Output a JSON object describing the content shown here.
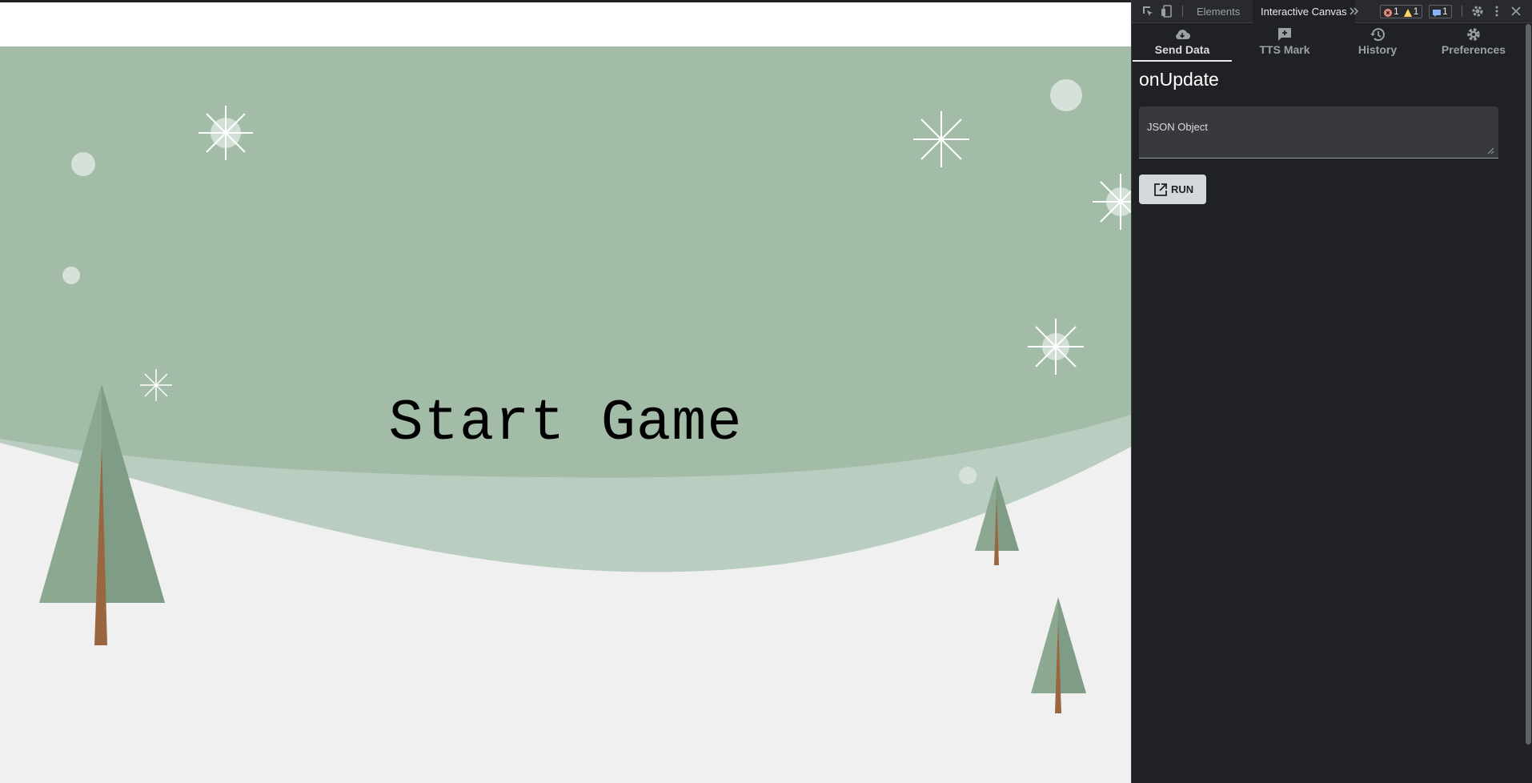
{
  "game": {
    "start_label": "Start Game",
    "colors": {
      "sky": "#a2bca8",
      "hill": "#b9cdc1",
      "ground": "#f0f0f0",
      "tree": "#8ca890",
      "trunk": "#9a6640",
      "snow": "#ffffff"
    }
  },
  "devtools": {
    "toolbar": {
      "tabs": [
        {
          "label": "Elements",
          "active": false
        },
        {
          "label": "Interactive Canvas",
          "active": true
        }
      ],
      "more_icon": "chevron-double-right-icon",
      "badges": {
        "errors": "1",
        "warnings": "1",
        "messages": "1"
      }
    },
    "nav": {
      "tabs": [
        {
          "label": "Send Data",
          "icon": "cloud-download-icon",
          "active": true
        },
        {
          "label": "TTS Mark",
          "icon": "add-comment-icon",
          "active": false
        },
        {
          "label": "History",
          "icon": "history-icon",
          "active": false
        },
        {
          "label": "Preferences",
          "icon": "gear-icon",
          "active": false
        }
      ]
    },
    "panel": {
      "title": "onUpdate",
      "json_label": "JSON Object",
      "json_value": "",
      "run_label": "RUN"
    },
    "colors": {
      "background": "#202124",
      "error": "#f28b82",
      "warning": "#fdd663",
      "info": "#8ab4f8"
    }
  }
}
